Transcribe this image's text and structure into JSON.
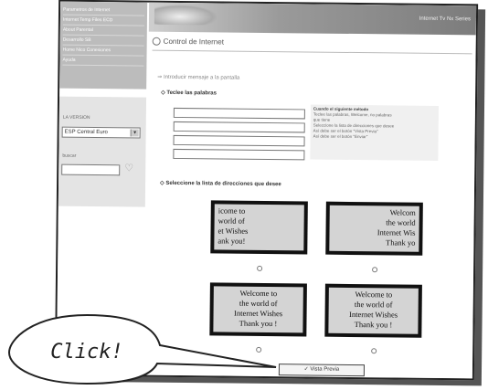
{
  "sidebar": {
    "nav_items": [
      "Parametros de Internet",
      "Internet Temp Files ECD",
      "About Parental",
      "Desarrollo SB",
      "Home Nico Conexiones",
      "Ayuda"
    ],
    "language_label": "LA VERSION",
    "language_value": "ESP Central Euro",
    "search_label": "buscar"
  },
  "banner": {
    "title": "Internet Tv Nx Series"
  },
  "main": {
    "page_title": "Control de Internet",
    "step_heading": "Introducir mensaje a la pantalla",
    "words_heading": "Teclee las palabras",
    "instructions": {
      "title": "Cuando el siguiente método",
      "lines": [
        "Teclee las palabras, Welcome, no palabras",
        "que tiene",
        "Seleccione la lista de direcciones que desee",
        "Así debe ser el botón \"Vista Previa\"",
        "Así debe ser el botón \"Enviar\""
      ]
    },
    "list_heading": "Seleccione la lista de direcciones que desee",
    "cards": [
      [
        "icome to",
        "world of",
        "et Wishes",
        "ank you!"
      ],
      [
        "Welcom",
        "the world",
        "Internet Wis",
        "Thank yo"
      ],
      [
        "Welcome to",
        "the world of",
        "Internet Wishes",
        "Thank you !"
      ],
      [
        "Welcome to",
        "the world of",
        "Internet Wishes",
        "Thank you !"
      ]
    ],
    "preview_button": "✓ Vista Previa"
  },
  "callout": {
    "text": "Click!"
  }
}
